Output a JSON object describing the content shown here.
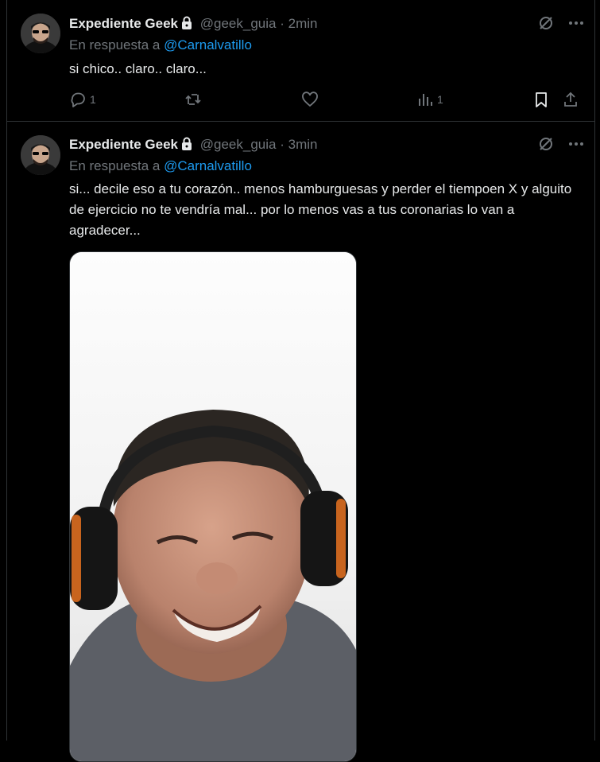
{
  "tweets": [
    {
      "author_name": "Expediente Geek",
      "handle": "@geek_guia",
      "separator": "·",
      "time": "2min",
      "reply_prefix": "En respuesta a",
      "reply_to": "@Carnalvatillo",
      "text": "si chico.. claro.. claro...",
      "replies_count": "1",
      "views_count": "1",
      "icons": [
        "grok-icon",
        "more-icon",
        "reply-icon",
        "retweet-icon",
        "like-icon",
        "views-icon",
        "bookmark-icon",
        "share-icon"
      ]
    },
    {
      "author_name": "Expediente Geek",
      "handle": "@geek_guia",
      "separator": "·",
      "time": "3min",
      "reply_prefix": "En respuesta a",
      "reply_to": "@Carnalvatillo",
      "text": "si... decile eso a tu corazón.. menos hamburguesas y perder el tiempoen X y alguito de ejercicio no te vendría mal... por lo menos vas a tus coronarias lo van a agradecer...",
      "media": "photo-selfie-with-headphones"
    }
  ],
  "colors": {
    "background": "#000000",
    "text": "#e7e9ea",
    "muted": "#71767b",
    "accent": "#1d9bf0",
    "border": "#2f3336"
  }
}
